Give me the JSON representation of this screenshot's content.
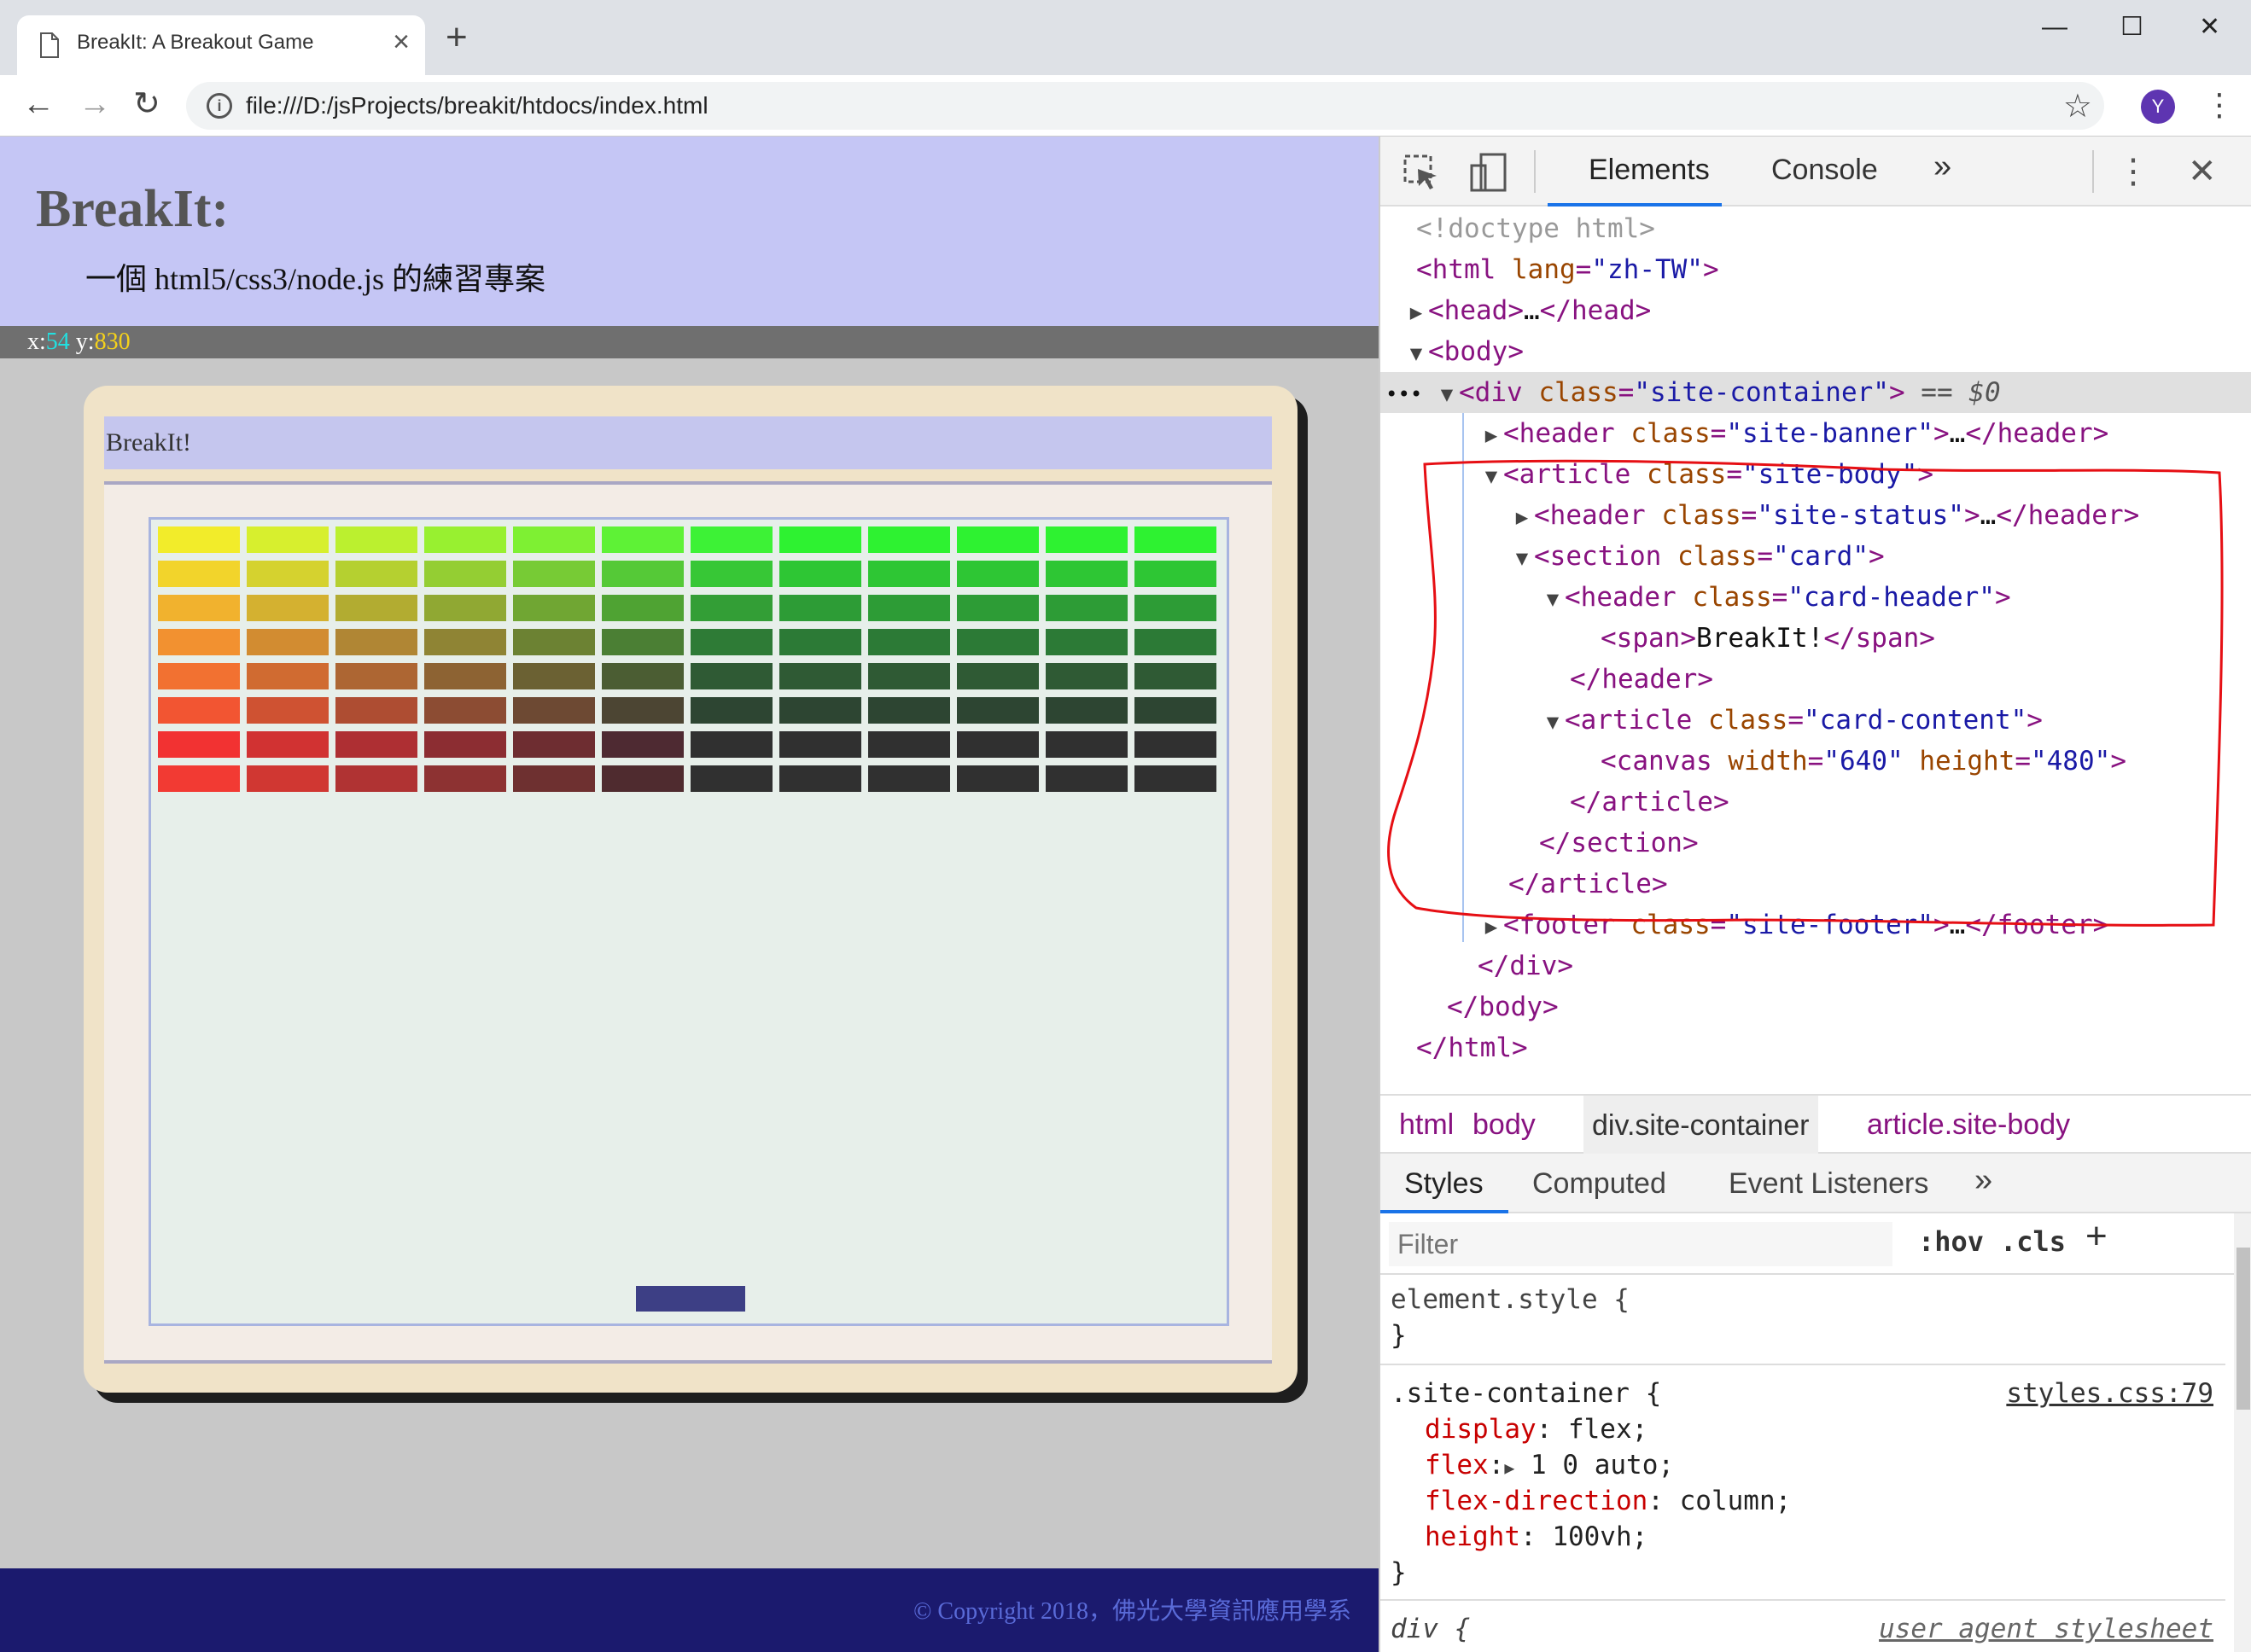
{
  "browser": {
    "tab_title": "BreakIt: A Breakout Game",
    "url": "file:///D:/jsProjects/breakit/htdocs/index.html",
    "avatar_letter": "Y"
  },
  "page": {
    "banner_title": "BreakIt:",
    "banner_subtitle": "一個 html5/css3/node.js 的練習專案",
    "status": {
      "x_label": "x:",
      "x_value": "54",
      "y_label": "y:",
      "y_value": "830"
    },
    "card_header": "BreakIt!",
    "footer": "© Copyright 2018，佛光大學資訊應用學系"
  },
  "game": {
    "brick_rows": [
      [
        "#f2ec2a",
        "#d7ef2e",
        "#bbf02f",
        "#98f030",
        "#7ef033",
        "#5ef236",
        "#3df236",
        "#2ef231",
        "#2ef231",
        "#2ef231",
        "#2ef231",
        "#2ef231"
      ],
      [
        "#f2d42b",
        "#d5d22f",
        "#b5d030",
        "#94ce33",
        "#77cb35",
        "#55c937",
        "#37c736",
        "#2ec634",
        "#2ec634",
        "#2ec634",
        "#2ec634",
        "#2ec634"
      ],
      [
        "#f1b22e",
        "#d4b130",
        "#b2ac31",
        "#90a833",
        "#70a633",
        "#4fa333",
        "#339e36",
        "#2d9c36",
        "#2d9c36",
        "#2d9c36",
        "#2d9c36",
        "#2d9c36"
      ],
      [
        "#f29130",
        "#d28c31",
        "#b08634",
        "#8f8434",
        "#6c8233",
        "#4b7f34",
        "#2e7b36",
        "#2c7a36",
        "#2c7a36",
        "#2c7a36",
        "#2c7a36",
        "#2c7a36"
      ],
      [
        "#f27131",
        "#d06b31",
        "#ad6633",
        "#8d6333",
        "#6b6133",
        "#4b5d33",
        "#2f5a34",
        "#2f5a34",
        "#2f5a34",
        "#2f5a34",
        "#2f5a34",
        "#2f5a34"
      ],
      [
        "#f25532",
        "#cf5232",
        "#ae4d32",
        "#8c4c33",
        "#6d4933",
        "#4c4533",
        "#2d4532",
        "#2d4532",
        "#2d4532",
        "#2d4532",
        "#2d4532",
        "#2d4532"
      ],
      [
        "#f23232",
        "#d13232",
        "#ae2f33",
        "#8c2d32",
        "#6e2d31",
        "#4e2a32",
        "#303030",
        "#303030",
        "#303030",
        "#303030",
        "#303030",
        "#303030"
      ],
      [
        "#f23a33",
        "#d03732",
        "#b03333",
        "#8d3232",
        "#6e3030",
        "#4f2b2f",
        "#303030",
        "#303030",
        "#303030",
        "#303030",
        "#303030",
        "#303030"
      ]
    ],
    "paddle_color": "#3d3f85"
  },
  "devtools": {
    "tabs": [
      "Elements",
      "Console"
    ],
    "more": "»",
    "dom": {
      "doctype": "<!doctype html>",
      "html_open_tag": "html",
      "html_lang_attr": "lang",
      "html_lang_val": "\"zh-TW\"",
      "head": "head",
      "head_ellipsis": "…",
      "body": "body",
      "div": "div",
      "class_attr": "class",
      "site_container": "\"site-container\"",
      "eq0": "== $0",
      "header": "header",
      "site_banner": "\"site-banner\"",
      "article": "article",
      "site_body": "\"site-body\"",
      "site_status": "\"site-status\"",
      "section": "section",
      "card": "\"card\"",
      "card_header": "\"card-header\"",
      "span": "span",
      "span_text": "BreakIt!",
      "card_content": "\"card-content\"",
      "canvas": "canvas",
      "width_attr": "width",
      "width_val": "\"640\"",
      "height_attr": "height",
      "height_val": "\"480\"",
      "footer": "footer",
      "site_footer": "\"site-footer\"",
      "ellipsis": "…"
    },
    "breadcrumbs": [
      "html",
      "body",
      "div.site-container",
      "article.site-body"
    ],
    "styles_tabs": [
      "Styles",
      "Computed",
      "Event Listeners"
    ],
    "filter_placeholder": "Filter",
    "hov": ":hov",
    "cls": ".cls",
    "plus": "+",
    "element_style_open": "element.style {",
    "close_brace": "}",
    "rule_selector": ".site-container {",
    "rule_source": "styles.css:79",
    "declarations": [
      {
        "prop": "display",
        "value": "flex;"
      },
      {
        "prop": "flex",
        "value": "1 0 auto;"
      },
      {
        "prop": "flex-direction",
        "value": "column;"
      },
      {
        "prop": "height",
        "value": "100vh;"
      }
    ],
    "next_selector": "div {",
    "next_source": "user agent stylesheet"
  }
}
